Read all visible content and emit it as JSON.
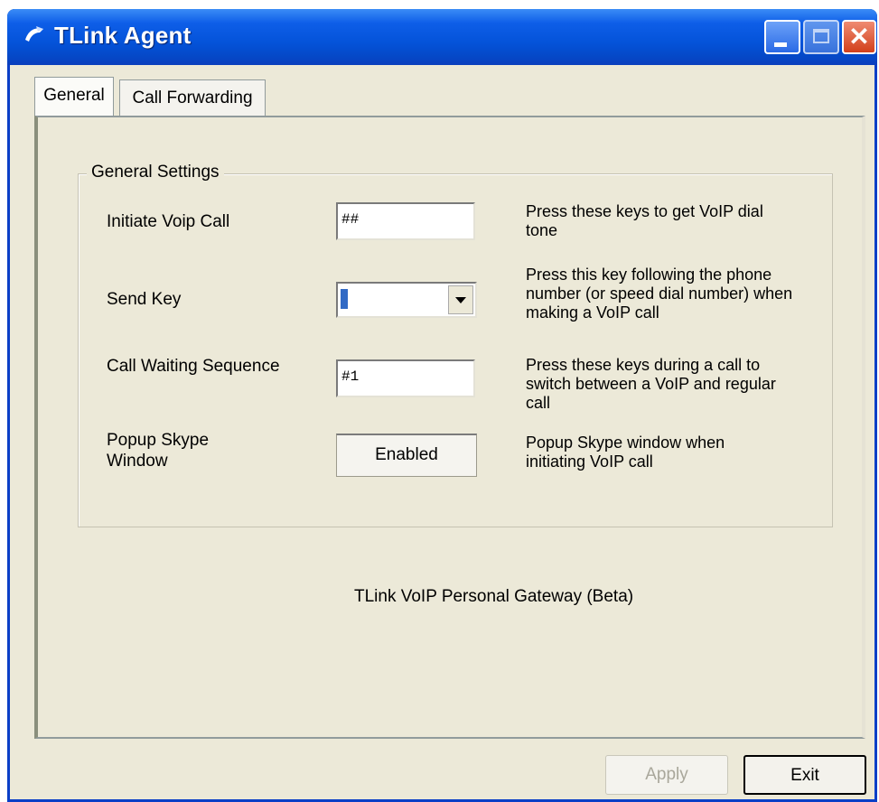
{
  "window": {
    "title": "TLink Agent"
  },
  "tabs": [
    {
      "label": "General"
    },
    {
      "label": "Call Forwarding"
    }
  ],
  "group": {
    "title": "General Settings",
    "rows": [
      {
        "label": "Initiate Voip Call",
        "value": "##",
        "description": "Press these keys to get VoIP dial tone"
      },
      {
        "label": "Send Key",
        "value": "",
        "description": "Press this key following the phone number (or speed dial number) when making a VoIP call"
      },
      {
        "label": "Call Waiting Sequence",
        "value": "#1",
        "description": "Press these keys during a call to switch between  a VoIP and regular call"
      },
      {
        "label": "Popup Skype Window",
        "value": "Enabled",
        "description": "Popup Skype window when initiating VoIP call"
      }
    ]
  },
  "footer": {
    "product": "TLink VoIP Personal Gateway (Beta)"
  },
  "buttons": {
    "apply": "Apply",
    "exit": "Exit"
  },
  "colors": {
    "titlebar": "#0453d9",
    "close": "#d2401b",
    "face": "#ece9d8"
  }
}
